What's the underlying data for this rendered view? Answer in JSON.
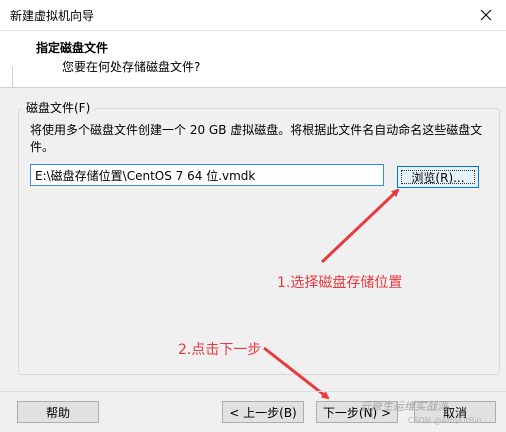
{
  "window": {
    "title": "新建虚拟机向导"
  },
  "header": {
    "title": "指定磁盘文件",
    "subtitle": "您要在何处存储磁盘文件?"
  },
  "group": {
    "label": "磁盘文件(F)",
    "description": "将使用多个磁盘文件创建一个 20 GB 虚拟磁盘。将根据此文件名自动命名这些磁盘文件。"
  },
  "path_input": {
    "value": "E:\\磁盘存储位置\\CentOS 7 64 位.vmdk"
  },
  "browse_button": {
    "label": "浏览(R)..."
  },
  "annotations": {
    "step1": "1.选择磁盘存储位置",
    "step2": "2.点击下一步"
  },
  "footer": {
    "help_label": "帮助",
    "back_label": "< 上一步(B)",
    "next_label": "下一步(N) >",
    "cancel_label": "取消"
  },
  "watermark": {
    "text": "云原生运维实战派",
    "sub": "CSDN @AmyOtBin"
  },
  "colors": {
    "annotation": "#e8393f",
    "focus_border": "#0078d7"
  },
  "icons": {
    "close": "close-icon"
  }
}
